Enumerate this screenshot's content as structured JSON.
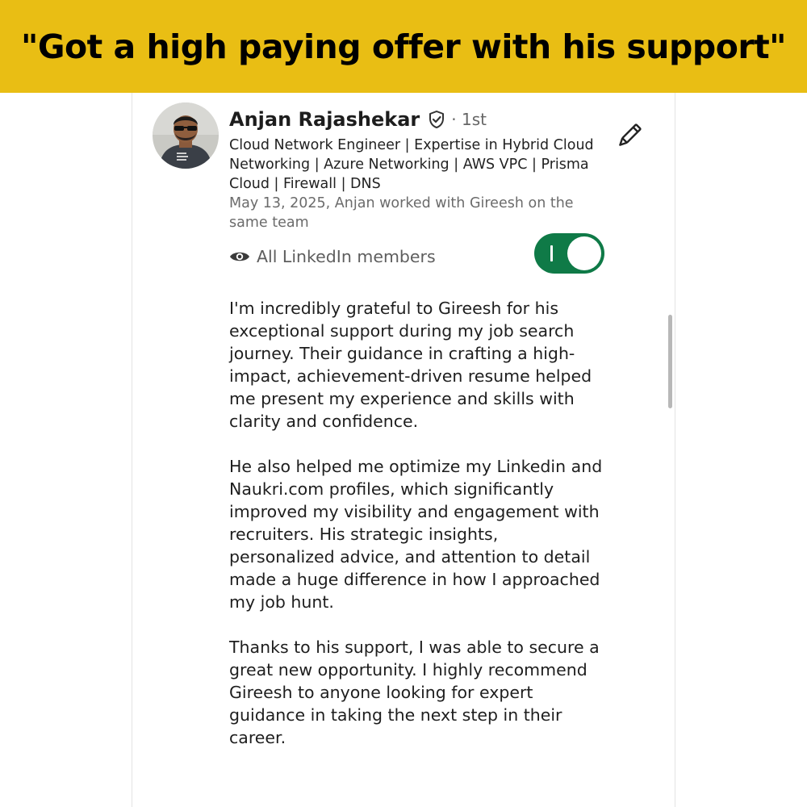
{
  "banner": {
    "headline": "\"Got a high paying offer with his support\"",
    "background_color": "#E9BE14"
  },
  "recommendation": {
    "author_name": "Anjan Rajashekar",
    "verified_icon": "shield-check-icon",
    "connection_degree": "· 1st",
    "headline": "Cloud Network Engineer | Expertise in Hybrid Cloud Networking | Azure Networking | AWS VPC | Prisma Cloud | Firewall | DNS",
    "relationship": "May 13, 2025, Anjan worked with Gireesh on the same team",
    "edit_icon": "pencil-icon",
    "visibility": {
      "icon": "eye-icon",
      "label": "All LinkedIn members",
      "toggle_on": true,
      "toggle_color": "#0F7A47"
    },
    "paragraphs": [
      "I'm incredibly grateful to Gireesh for his exceptional support during my job search journey. Their guidance in crafting a high-impact, achievement-driven resume helped me present my experience and skills with clarity and confidence.",
      "He also helped me optimize my Linkedin and Naukri.com profiles, which significantly improved my visibility and engagement with recruiters. His strategic insights, personalized advice, and attention to detail made a huge difference in how I approached my job hunt.",
      "Thanks to his support, I was able to secure a great new opportunity. I highly recommend Gireesh to anyone looking for expert guidance in taking the next step in their career."
    ]
  }
}
